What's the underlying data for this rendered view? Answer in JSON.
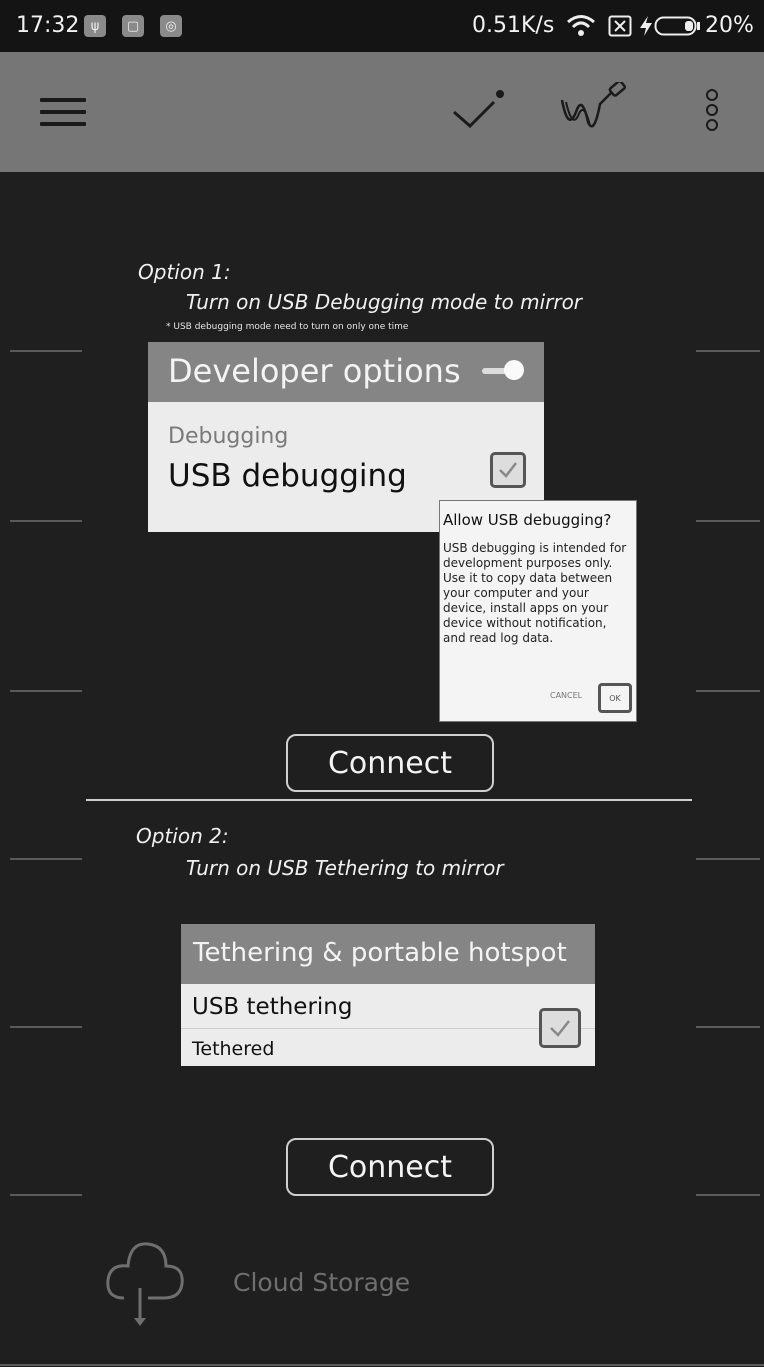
{
  "status_bar": {
    "time": "17:32",
    "net_speed": "0.51K/s",
    "battery": "20%",
    "icons": [
      "usb-icon",
      "notification-icon",
      "app-icon",
      "wifi-icon",
      "sim-icon",
      "charging-icon",
      "battery-icon"
    ]
  },
  "toolbar": {
    "icons": [
      "menu-icon",
      "check-icon",
      "cable-icon",
      "more-options-icon"
    ]
  },
  "option1": {
    "label": "Option 1:",
    "title": "Turn on USB Debugging mode to mirror",
    "note": "* USB debugging mode need to turn on only one time",
    "card_header": "Developer options",
    "section": "Debugging",
    "item": "USB debugging",
    "dialog": {
      "title": "Allow USB debugging?",
      "body": "USB debugging is intended for development purposes only. Use it to copy data between your computer and your device, install apps on your device without notification, and read log data.",
      "cancel": "CANCEL",
      "ok": "OK"
    },
    "connect": "Connect"
  },
  "option2": {
    "label": "Option 2:",
    "title": "Turn on USB Tethering to mirror",
    "card_header": "Tethering & portable hotspot",
    "item": "USB tethering",
    "subtitle": "Tethered",
    "connect": "Connect"
  },
  "footer": {
    "cloud_label": "Cloud Storage"
  },
  "colors": {
    "toolbar": "#767676",
    "background": "#1f1f1f",
    "status_bar": "#141414"
  }
}
